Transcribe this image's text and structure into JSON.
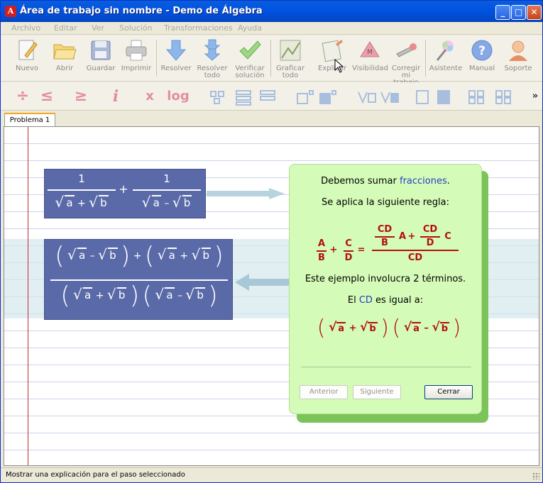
{
  "window": {
    "title": "Área de trabajo sin nombre - Demo de Álgebra",
    "min_label": "_",
    "max_label": "□",
    "close_label": "✕"
  },
  "menu": [
    "Archivo",
    "Editar",
    "Ver",
    "Solución",
    "Transformaciones",
    "Ayuda"
  ],
  "toolbar": {
    "items": [
      {
        "label": "Nuevo",
        "icon": "new-document-icon"
      },
      {
        "label": "Abrir",
        "icon": "open-folder-icon"
      },
      {
        "label": "Guardar",
        "icon": "save-disk-icon"
      },
      {
        "label": "Imprimir",
        "icon": "printer-icon"
      },
      {
        "label": "Resolver",
        "icon": "arrow-down-icon"
      },
      {
        "label": "Resolver\ntodo",
        "icon": "double-arrow-down-icon"
      },
      {
        "label": "Verificar\nsolución",
        "icon": "checkmark-icon"
      },
      {
        "label": "Graficar\ntodo",
        "icon": "graph-icon"
      },
      {
        "label": "Explicar",
        "icon": "explain-document-icon"
      },
      {
        "label": "Visibilidad",
        "icon": "visibility-icon"
      },
      {
        "label": "Corregir\nmi trabajo",
        "icon": "correct-wrench-icon"
      },
      {
        "label": "Asistente",
        "icon": "wizard-icon"
      },
      {
        "label": "Manual",
        "icon": "help-icon"
      },
      {
        "label": "Soporte",
        "icon": "support-person-icon"
      }
    ],
    "overflow_label": "»"
  },
  "toolbar2": {
    "divide": "÷",
    "le": "≤",
    "ge": "≥",
    "italic_i": "i",
    "subscript_x": "x",
    "log": "log"
  },
  "tabs": [
    {
      "label": "Problema 1"
    }
  ],
  "math": {
    "numerator_one": "1",
    "plus": "+",
    "minus": "–",
    "a": "a",
    "b": "b"
  },
  "explanation": {
    "line1_prefix": "Debemos sumar ",
    "line1_link": "fracciones",
    "line1_suffix": ".",
    "line2": "Se aplica la siguiente regla:",
    "rule": {
      "A": "A",
      "B": "B",
      "C": "C",
      "D": "D",
      "CD": "CD",
      "plus": "+",
      "eq": "="
    },
    "line3": "Este ejemplo involucra 2 términos.",
    "line4_prefix": "El ",
    "line4_link": "CD",
    "line4_suffix": " es igual a:",
    "buttons": {
      "prev": "Anterior",
      "next": "Siguiente",
      "close": "Cerrar"
    }
  },
  "status": {
    "text": "Mostrar una explicación para el paso seleccionado"
  },
  "colors": {
    "title_bar": "#0054e3",
    "math_block": "#5a6aa8",
    "panel_bg": "#d5fbb8",
    "panel_shadow": "#7cc35a",
    "rule_red": "#b30f0f",
    "link_blue": "#1f3fc4",
    "margin_red": "#c02a2a"
  }
}
